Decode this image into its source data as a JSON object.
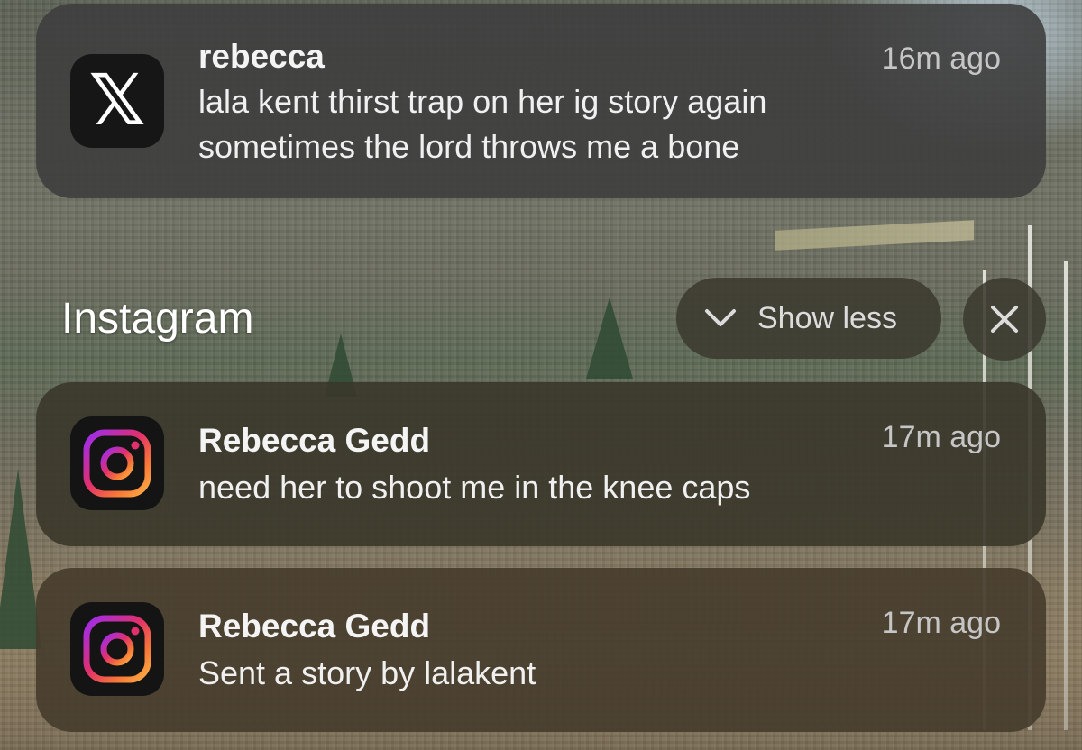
{
  "notifications_top": {
    "app_icon": "x-logo-icon",
    "sender": "rebecca",
    "time": "16m ago",
    "lines": [
      "lala kent thirst trap on her ig story again",
      "sometimes the lord throws me a bone"
    ]
  },
  "group": {
    "title": "Instagram",
    "show_less_label": "Show less",
    "show_less_icon": "chevron-down-icon",
    "close_icon": "close-icon",
    "items": [
      {
        "app_icon": "instagram-icon",
        "sender": "Rebecca Gedd",
        "time": "17m ago",
        "message": "need her to shoot me in the knee caps"
      },
      {
        "app_icon": "instagram-icon",
        "sender": "Rebecca Gedd",
        "time": "17m ago",
        "message": "Sent a story by lalakent"
      }
    ]
  },
  "colors": {
    "instagram_gradient": [
      "#9b2cf2",
      "#e1306c",
      "#f77737",
      "#fcaf45"
    ],
    "x_icon_bg": "#161616"
  }
}
